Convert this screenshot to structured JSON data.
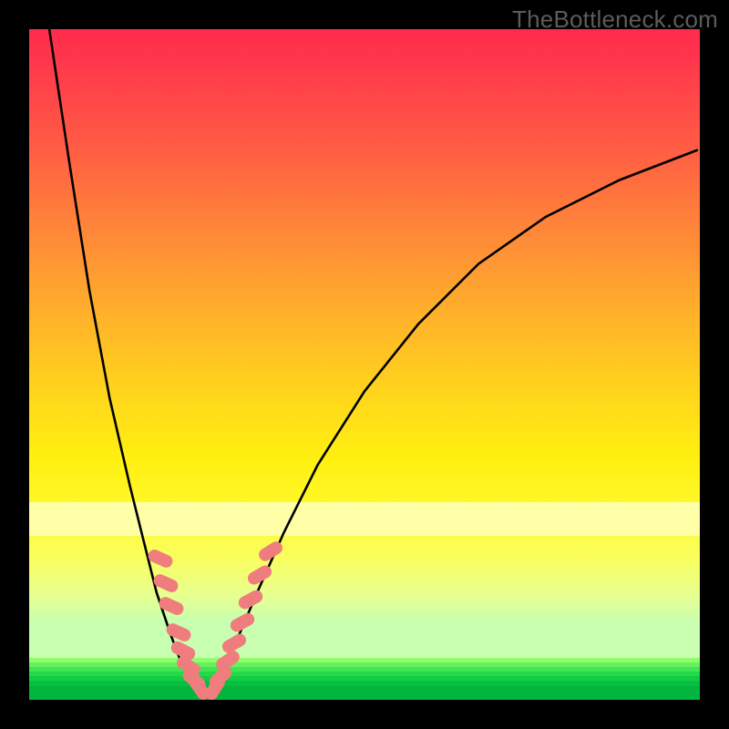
{
  "watermark": "TheBottleneck.com",
  "colors": {
    "frame_bg": "#000000",
    "curve": "#000000",
    "marker": "#f07d7d",
    "gradient_top": "#ff2a4d",
    "gradient_bottom": "#c8ffb0"
  },
  "chart_data": {
    "type": "line",
    "title": "",
    "xlabel": "",
    "ylabel": "",
    "xlim": [
      0,
      100
    ],
    "ylim": [
      0,
      100
    ],
    "note": "Axes are unlabeled in the image; values below are estimated as percent of plot area (0,0 = bottom-left).",
    "series": [
      {
        "name": "left-branch",
        "x": [
          3,
          6,
          9,
          12,
          15,
          17,
          19,
          21,
          22.5,
          24,
          25.3
        ],
        "y": [
          100,
          80,
          61,
          45,
          32,
          24,
          16,
          10,
          6,
          3,
          1.3
        ]
      },
      {
        "name": "right-branch",
        "x": [
          27.5,
          29,
          31,
          34,
          38,
          43,
          50,
          58,
          67,
          77,
          88,
          99.7
        ],
        "y": [
          1.3,
          4,
          9,
          16,
          25,
          35,
          46,
          56,
          65,
          72,
          77.5,
          82
        ]
      }
    ],
    "bands": [
      {
        "name": "pale-yellow",
        "y_from": 24.5,
        "y_to": 29.5,
        "color": "#ffffa8"
      },
      {
        "name": "green-1",
        "y_from": 5.6,
        "y_to": 6.2,
        "color": "#8cff6a"
      },
      {
        "name": "green-2",
        "y_from": 4.9,
        "y_to": 5.6,
        "color": "#63f25d"
      },
      {
        "name": "green-3",
        "y_from": 4.2,
        "y_to": 4.9,
        "color": "#3fe552"
      },
      {
        "name": "green-4",
        "y_from": 3.5,
        "y_to": 4.2,
        "color": "#24d84a"
      },
      {
        "name": "green-5",
        "y_from": 2.8,
        "y_to": 3.5,
        "color": "#12cc44"
      },
      {
        "name": "green-6",
        "y_from": 2.1,
        "y_to": 2.8,
        "color": "#08c040"
      },
      {
        "name": "green-7",
        "y_from": 0.0,
        "y_to": 2.1,
        "color": "#02b53c"
      }
    ],
    "markers": [
      {
        "branch": "left",
        "x": 19.5,
        "y": 21.0,
        "rot": -66
      },
      {
        "branch": "left",
        "x": 20.4,
        "y": 17.4,
        "rot": -66
      },
      {
        "branch": "left",
        "x": 21.2,
        "y": 14.0,
        "rot": -66
      },
      {
        "branch": "left",
        "x": 22.3,
        "y": 10.0,
        "rot": -66
      },
      {
        "branch": "left",
        "x": 23.0,
        "y": 7.4,
        "rot": -63
      },
      {
        "branch": "left",
        "x": 23.8,
        "y": 5.0,
        "rot": -58
      },
      {
        "branch": "left",
        "x": 24.6,
        "y": 3.0,
        "rot": -50
      },
      {
        "branch": "left",
        "x": 25.4,
        "y": 1.7,
        "rot": -35
      },
      {
        "branch": "right",
        "x": 27.7,
        "y": 1.7,
        "rot": 32
      },
      {
        "branch": "right",
        "x": 28.6,
        "y": 3.4,
        "rot": 48
      },
      {
        "branch": "right",
        "x": 29.6,
        "y": 5.8,
        "rot": 56
      },
      {
        "branch": "right",
        "x": 30.6,
        "y": 8.4,
        "rot": 60
      },
      {
        "branch": "right",
        "x": 31.8,
        "y": 11.6,
        "rot": 62
      },
      {
        "branch": "right",
        "x": 33.0,
        "y": 15.0,
        "rot": 62
      },
      {
        "branch": "right",
        "x": 34.4,
        "y": 18.6,
        "rot": 60
      },
      {
        "branch": "right",
        "x": 36.0,
        "y": 22.2,
        "rot": 58
      }
    ]
  }
}
